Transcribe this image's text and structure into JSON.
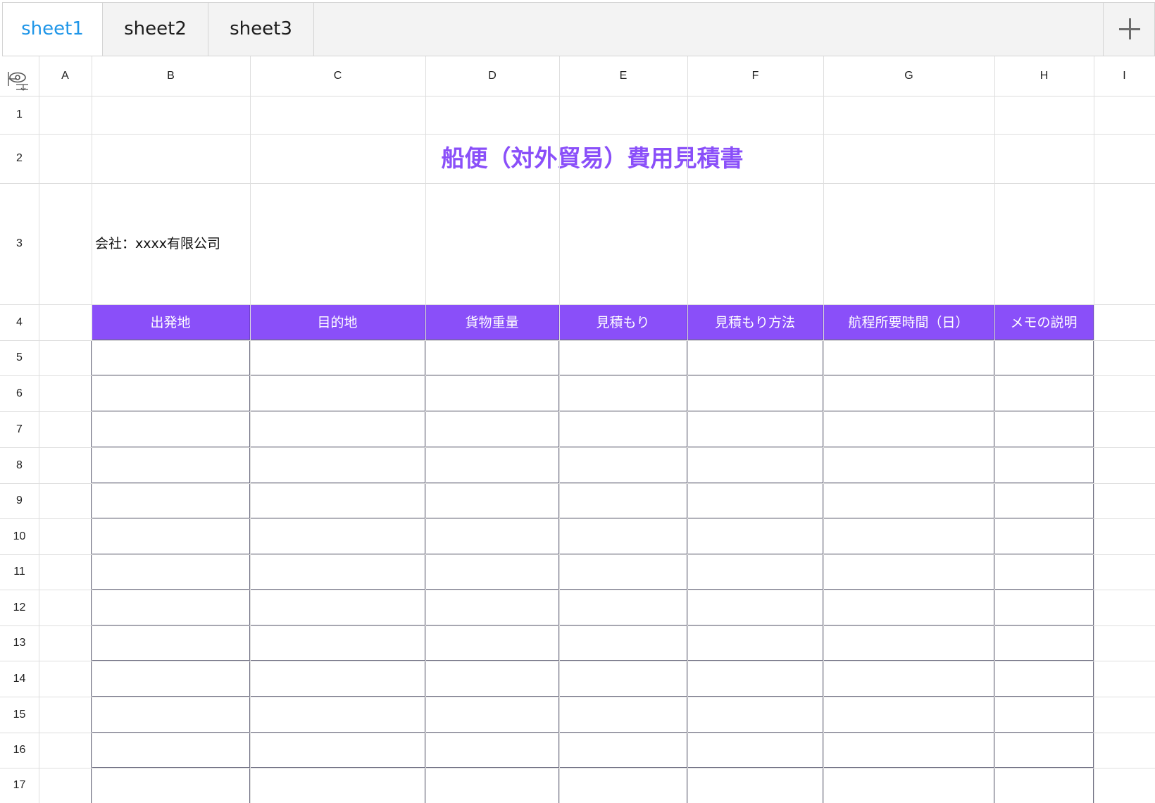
{
  "tabs": [
    {
      "label": "sheet1",
      "active": true
    },
    {
      "label": "sheet2",
      "active": false
    },
    {
      "label": "sheet3",
      "active": false
    }
  ],
  "add_tab_icon": "plus-icon",
  "corner_icon": "eye-freeze-icon",
  "columns": [
    "A",
    "B",
    "C",
    "D",
    "E",
    "F",
    "G",
    "H",
    "I"
  ],
  "rows": [
    "1",
    "2",
    "3",
    "4",
    "5",
    "6",
    "7",
    "8",
    "9",
    "10",
    "11",
    "12",
    "13",
    "14",
    "15",
    "16",
    "17"
  ],
  "sheet": {
    "title": "船便（対外貿易）費用見積書",
    "company": "会社：xxxx有限公司",
    "table_headers": [
      "出発地",
      "目的地",
      "貨物重量",
      "見積もり",
      "見積もり方法",
      "航程所要時間（日）",
      "メモの説明"
    ],
    "data_rows": [
      5,
      6,
      7,
      8,
      9,
      10,
      11,
      12,
      13,
      14,
      15,
      16,
      17
    ]
  },
  "colors": {
    "accent": "#8a4ff9",
    "active_tab": "#1f96e8",
    "table_border": "#6e6e82"
  }
}
